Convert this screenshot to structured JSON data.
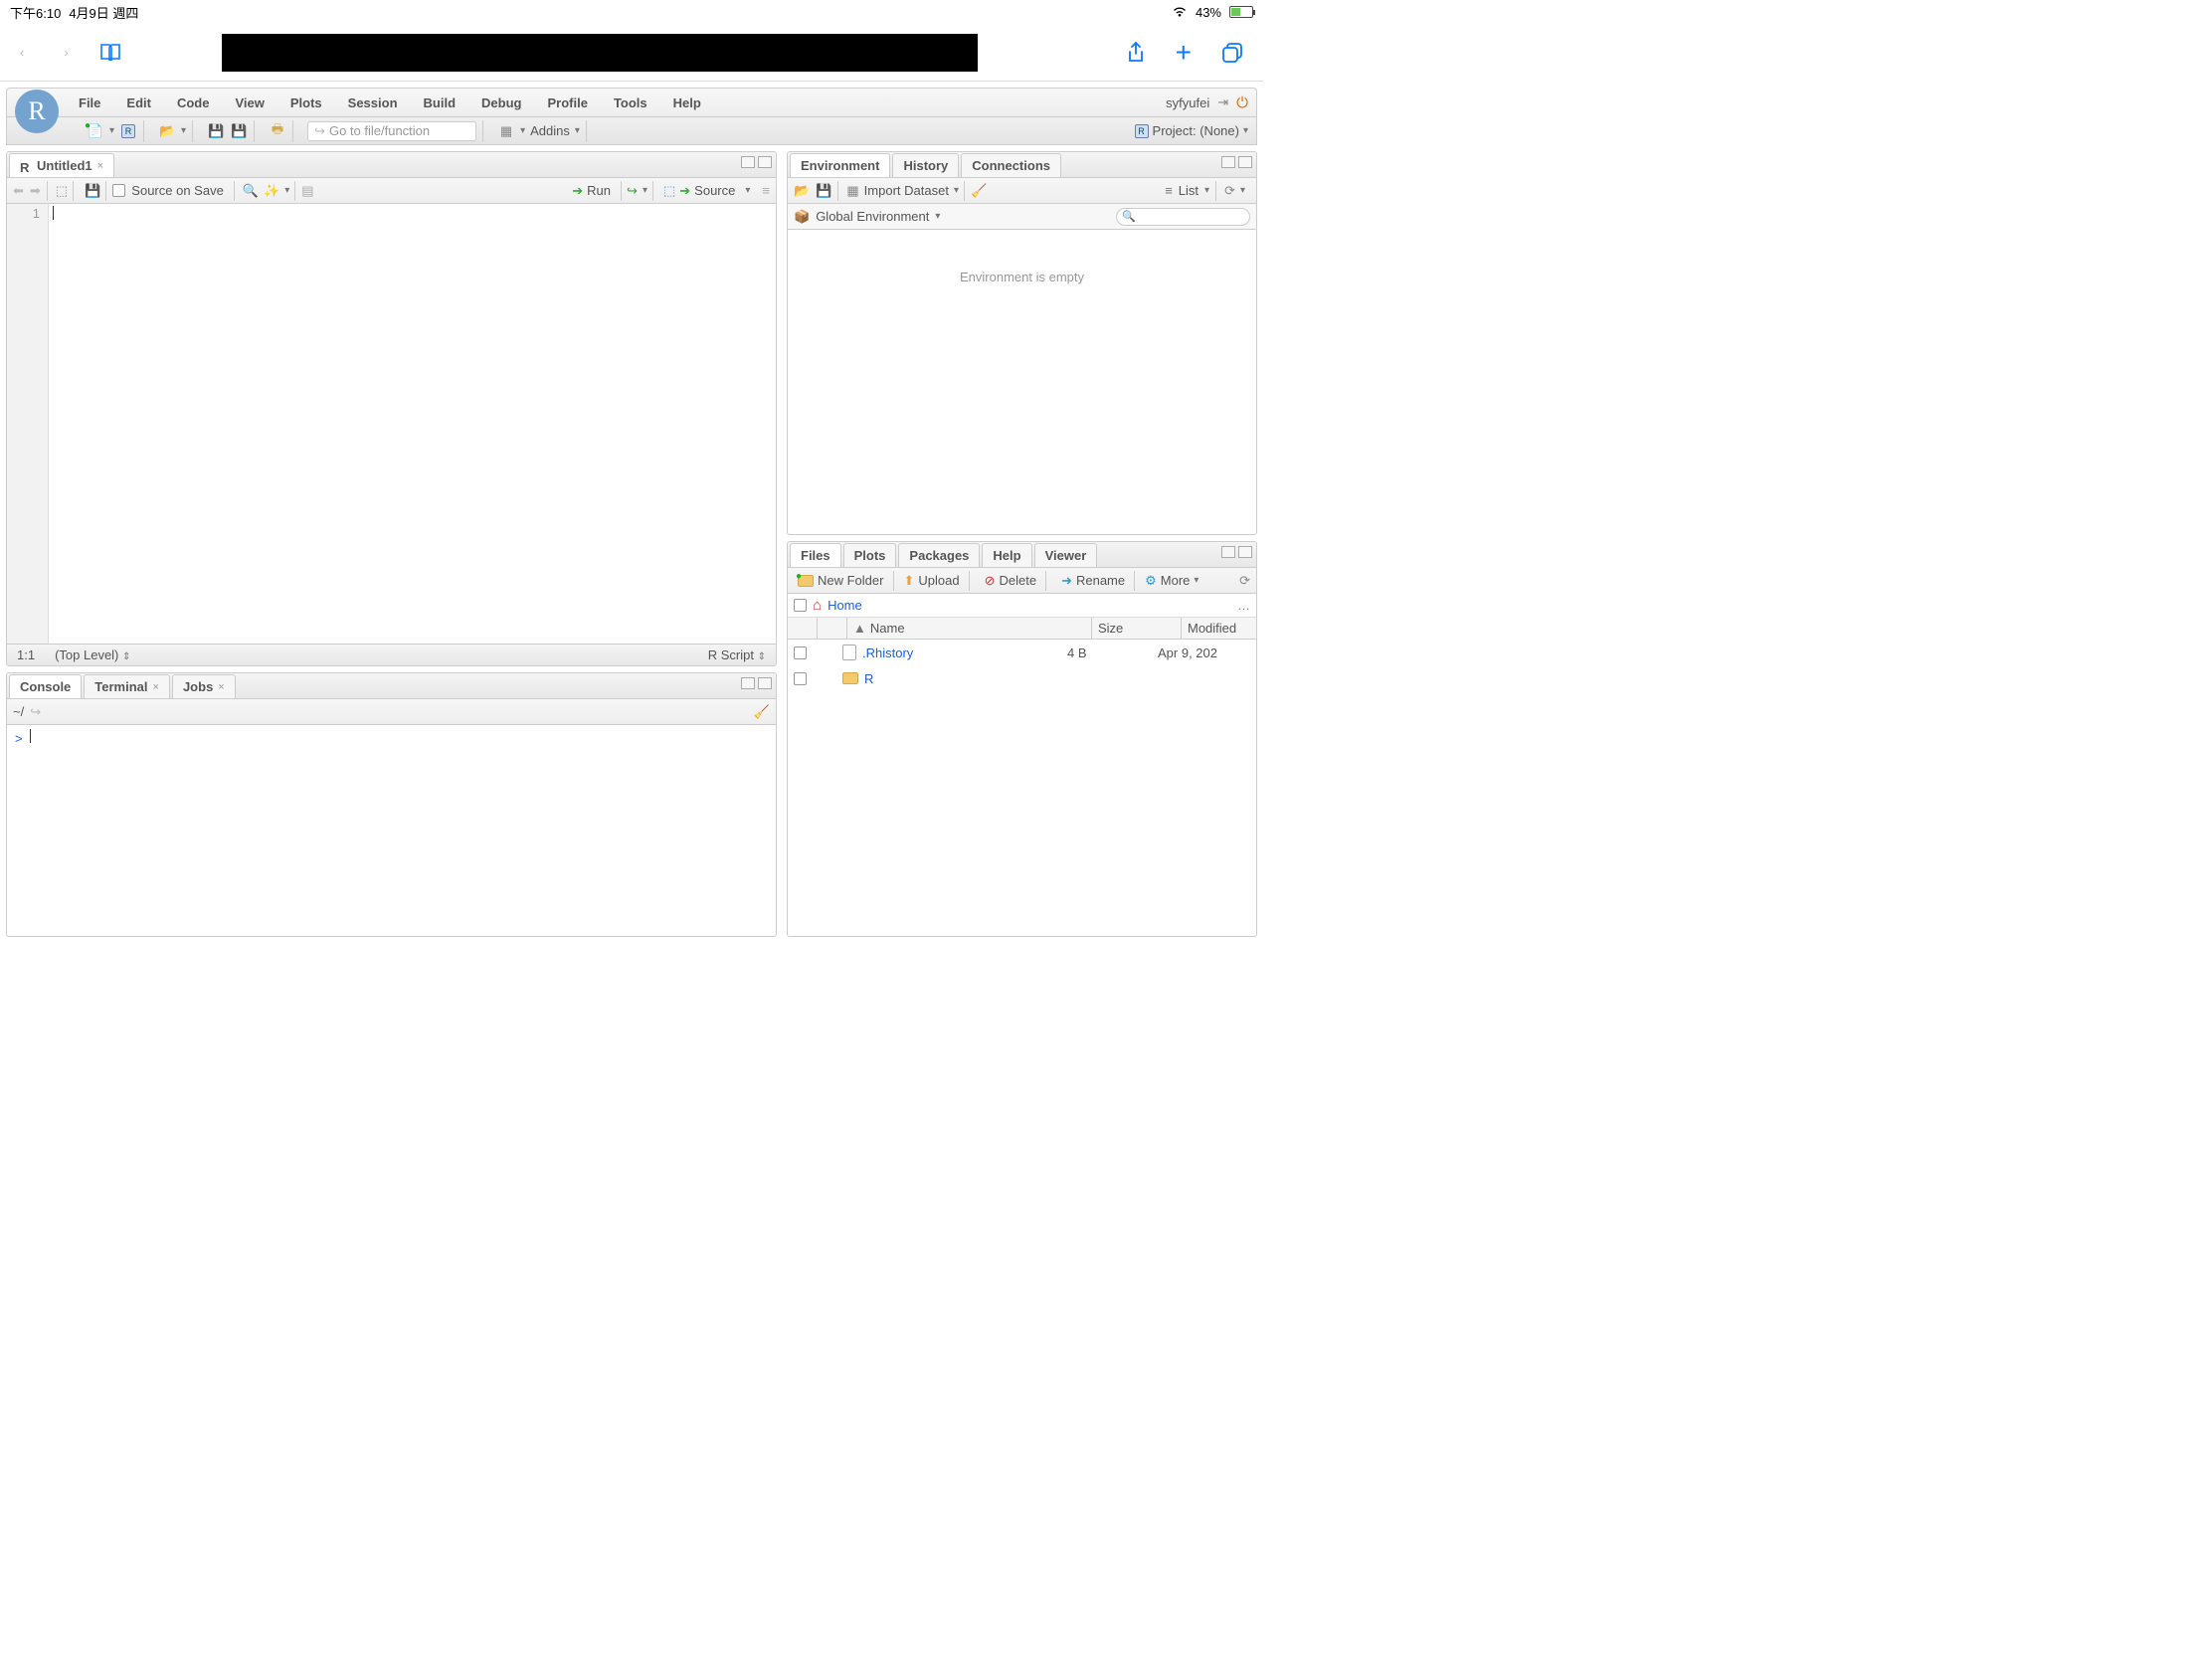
{
  "ipad": {
    "time": "下午6:10",
    "date": "4月9日 週四",
    "battery": "43%"
  },
  "menu": {
    "items": [
      "File",
      "Edit",
      "Code",
      "View",
      "Plots",
      "Session",
      "Build",
      "Debug",
      "Profile",
      "Tools",
      "Help"
    ],
    "user": "syfyufei"
  },
  "toolbar": {
    "goto_placeholder": "Go to file/function",
    "addins": "Addins",
    "project": "Project: (None)"
  },
  "editor": {
    "tab_title": "Untitled1",
    "source_on_save": "Source on Save",
    "run": "Run",
    "source": "Source",
    "pos": "1:1",
    "scope": "(Top Level)",
    "lang": "R Script",
    "line1": "1"
  },
  "console": {
    "tabs": [
      "Console",
      "Terminal",
      "Jobs"
    ],
    "path": "~/",
    "prompt": ">"
  },
  "env": {
    "tabs": [
      "Environment",
      "History",
      "Connections"
    ],
    "import": "Import Dataset",
    "view": "List",
    "scope": "Global Environment",
    "empty": "Environment is empty"
  },
  "files": {
    "tabs": [
      "Files",
      "Plots",
      "Packages",
      "Help",
      "Viewer"
    ],
    "buttons": {
      "new": "New Folder",
      "upload": "Upload",
      "delete": "Delete",
      "rename": "Rename",
      "more": "More"
    },
    "breadcrumb": "Home",
    "cols": {
      "name": "Name",
      "size": "Size",
      "modified": "Modified"
    },
    "rows": [
      {
        "name": ".Rhistory",
        "size": "4 B",
        "modified": "Apr 9, 202",
        "type": "file"
      },
      {
        "name": "R",
        "size": "",
        "modified": "",
        "type": "folder"
      }
    ]
  }
}
